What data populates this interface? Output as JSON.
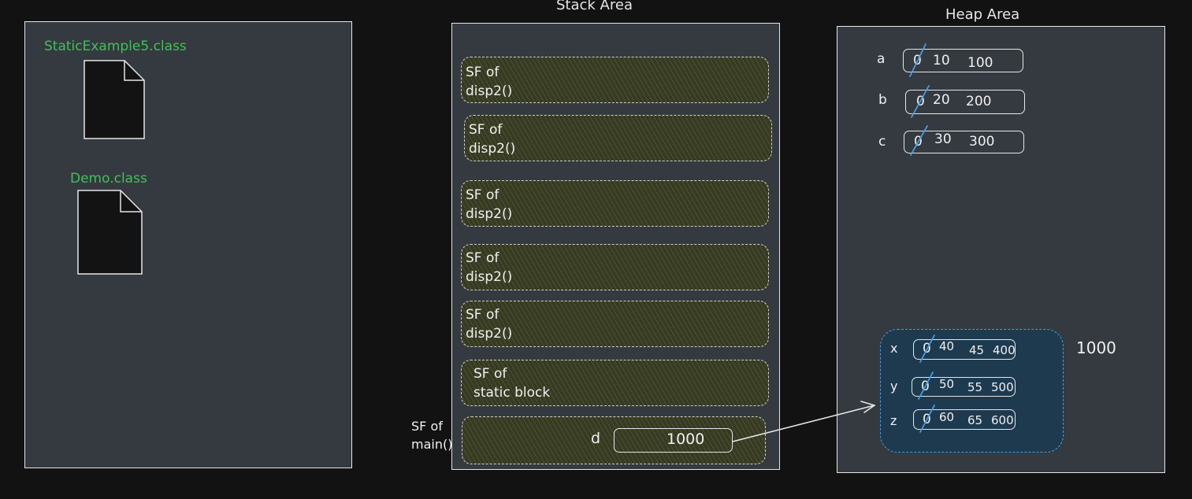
{
  "method_area": {
    "class1": "StaticExample5.class",
    "class2": "Demo.class"
  },
  "stack": {
    "title": "Stack Area",
    "frames": [
      "SF of\ndisp2()",
      "SF of\ndisp2()",
      "SF of\ndisp2()",
      "SF of\ndisp2()",
      "SF of\ndisp2()",
      "SF of\nstatic block"
    ],
    "main_label": "SF of\nmain()",
    "main_var": "d",
    "main_value": "1000"
  },
  "heap": {
    "title": "Heap Area",
    "static_vars": [
      {
        "name": "a",
        "old": "0",
        "values": [
          "10",
          "100"
        ]
      },
      {
        "name": "b",
        "old": "0",
        "values": [
          "20",
          "200"
        ]
      },
      {
        "name": "c",
        "old": "0",
        "values": [
          "30",
          "300"
        ]
      }
    ],
    "object_address": "1000",
    "object_vars": [
      {
        "name": "x",
        "old": "0",
        "values": [
          "40",
          "45",
          "400"
        ]
      },
      {
        "name": "y",
        "old": "0",
        "values": [
          "50",
          "55",
          "500"
        ]
      },
      {
        "name": "z",
        "old": "0",
        "values": [
          "60",
          "65",
          "600"
        ]
      }
    ]
  },
  "colors": {
    "background": "#121212",
    "panel": "#343a40",
    "class_label": "#40c057",
    "stack_frame": "#363a25",
    "object_fill": "#1e3a4f",
    "object_border": "#4a9be0",
    "strike": "#4a9be0"
  }
}
